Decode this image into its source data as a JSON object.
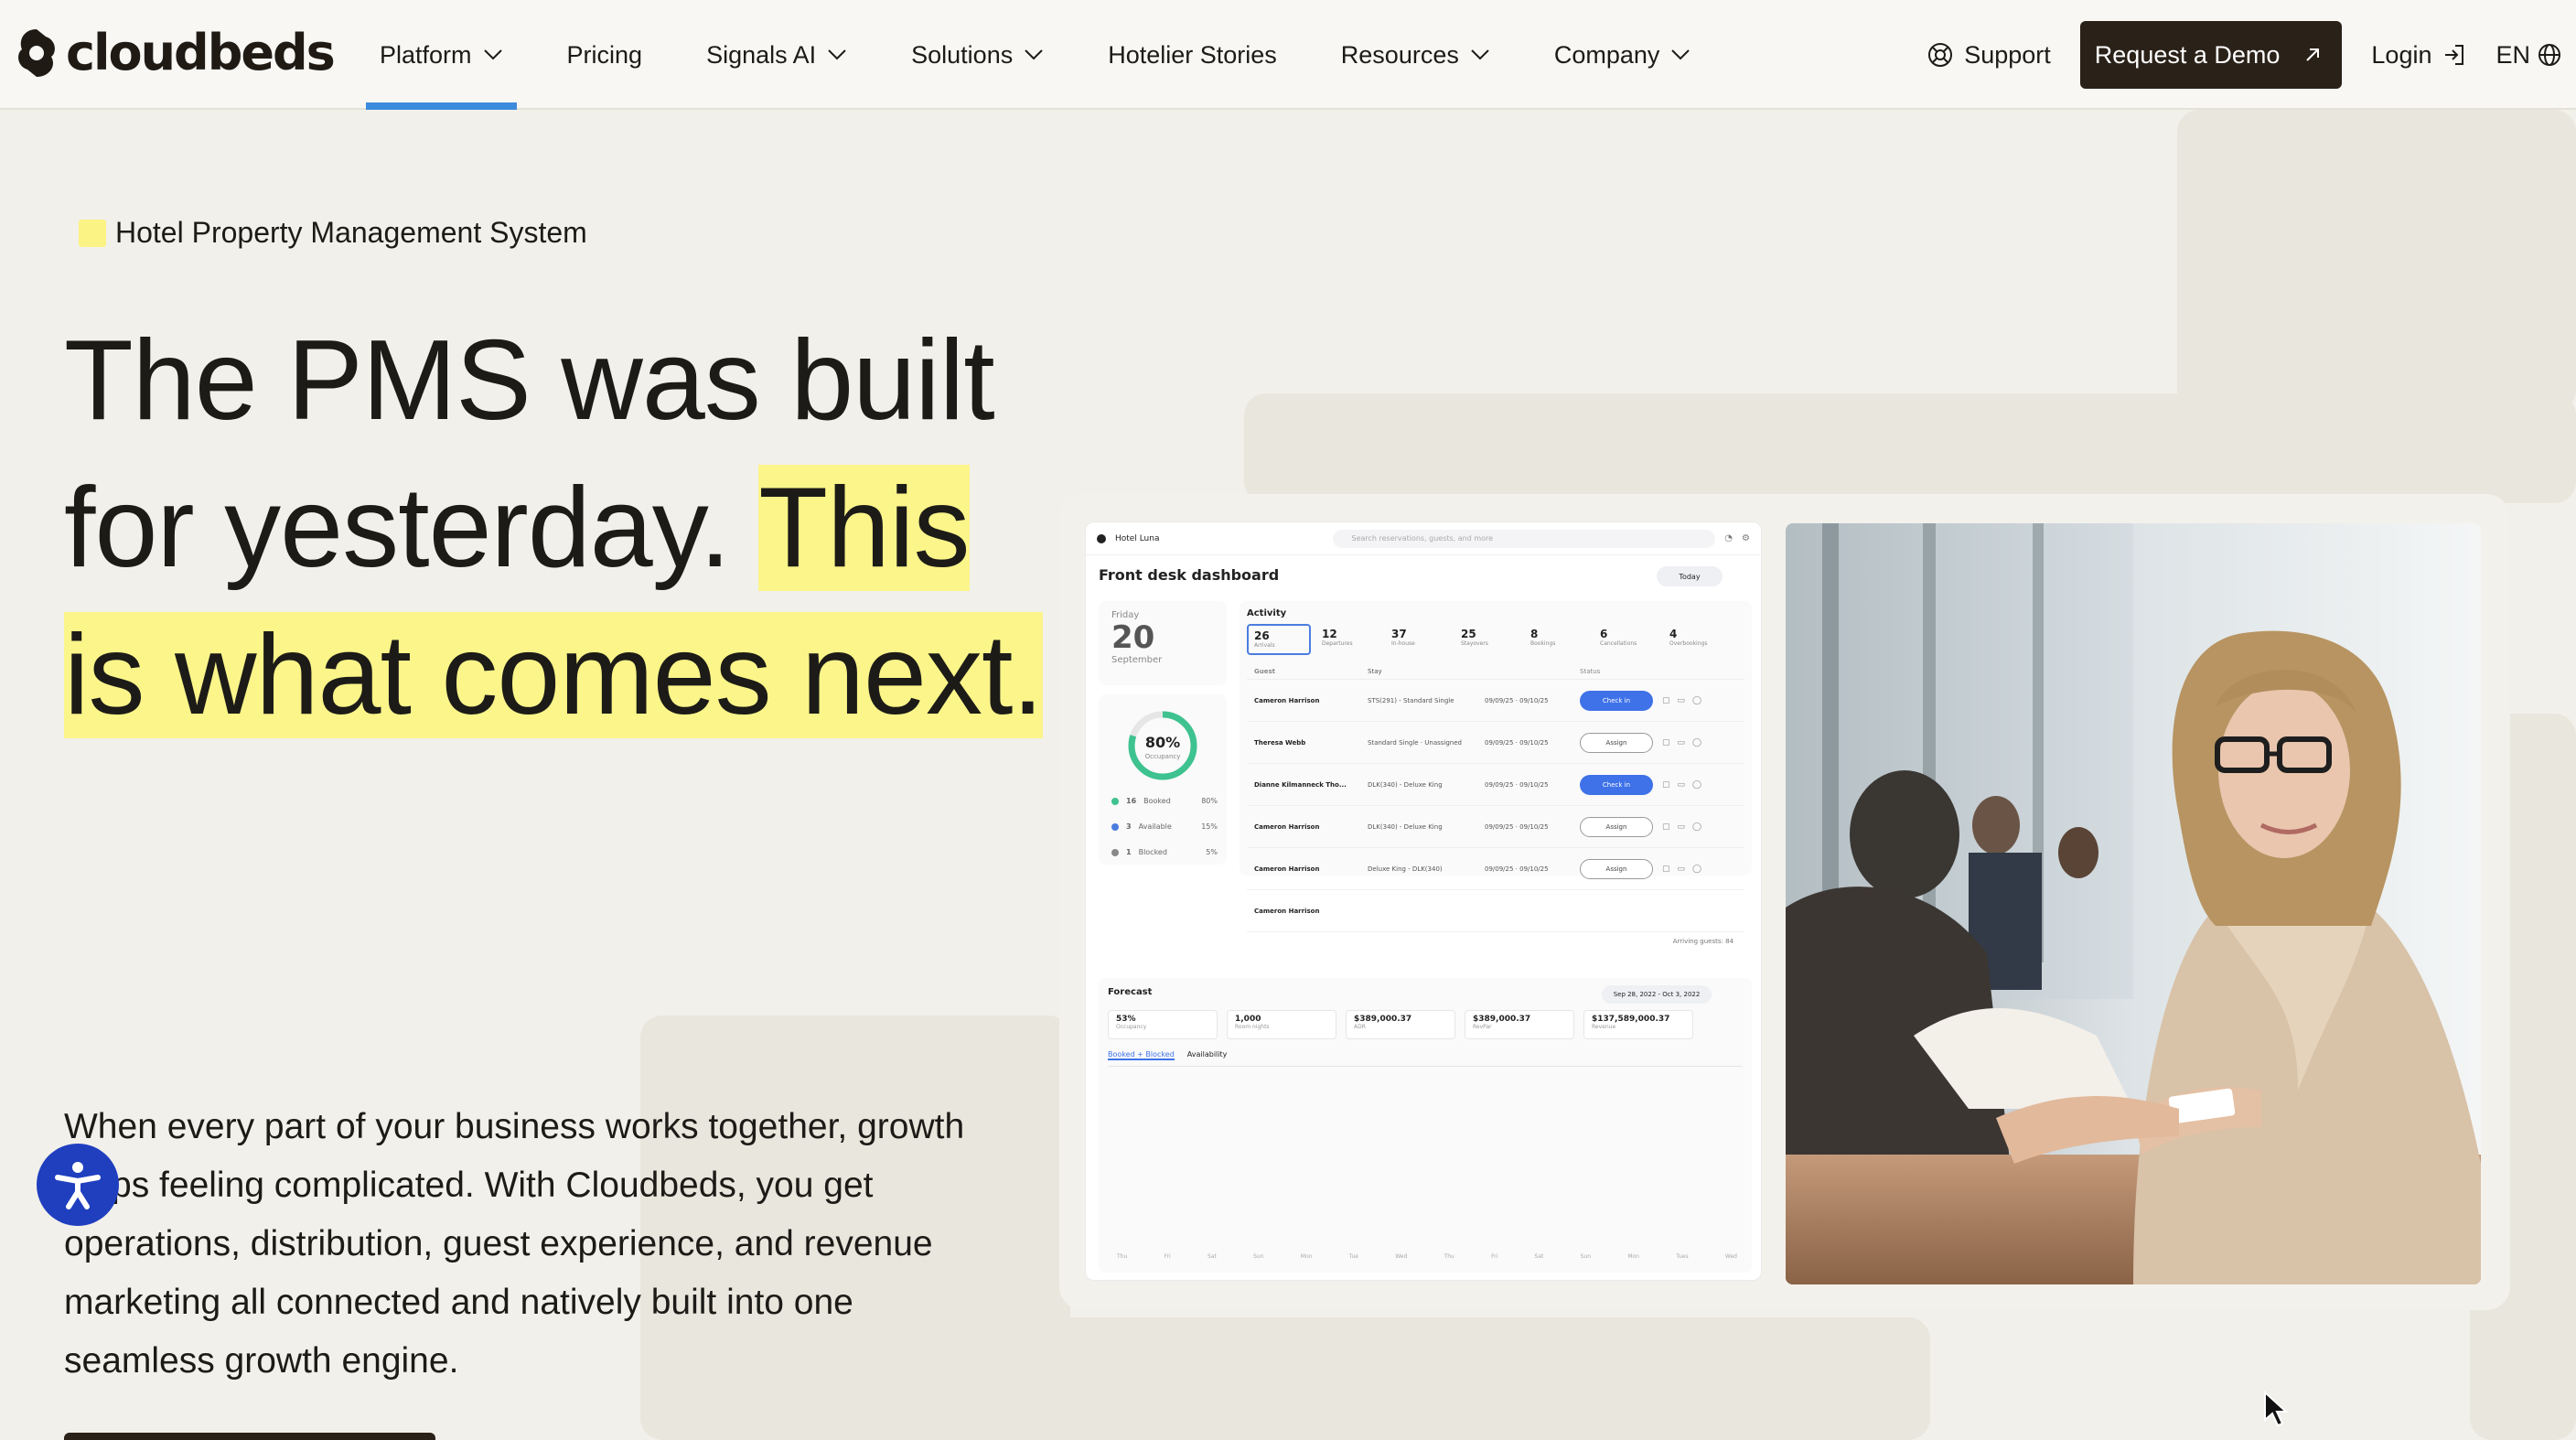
{
  "header": {
    "logo_text": "cloudbeds",
    "nav": [
      {
        "label": "Platform",
        "dropdown": true
      },
      {
        "label": "Pricing",
        "dropdown": false
      },
      {
        "label": "Signals AI",
        "dropdown": true
      },
      {
        "label": "Solutions",
        "dropdown": true
      },
      {
        "label": "Hotelier Stories",
        "dropdown": false
      },
      {
        "label": "Resources",
        "dropdown": true
      },
      {
        "label": "Company",
        "dropdown": true
      }
    ],
    "support_label": "Support",
    "demo_label": "Request a Demo",
    "login_label": "Login",
    "lang_label": "EN"
  },
  "hero": {
    "eyebrow": "Hotel Property Management System",
    "headline_plain": "The PMS was built for yesterday.",
    "headline_highlight": "This is what comes next.",
    "subcopy": "When every part of your business works together, growth stops feeling complicated. With Cloudbeds, you get operations, distribution, guest experience, and revenue marketing all connected and natively built into one seamless growth engine."
  },
  "dashboard": {
    "hotel_name": "Hotel Luna",
    "search_placeholder": "Search reservations, guests, and more",
    "title": "Front desk dashboard",
    "today_label": "Today",
    "date": {
      "dow": "Friday",
      "day": "20",
      "month": "September"
    },
    "occupancy": {
      "value": "80%",
      "label": "Occupancy",
      "fraction": 0.8,
      "rows": [
        {
          "count": "16",
          "label": "Booked",
          "pct": "80%",
          "color": "#3ec28f"
        },
        {
          "count": "3",
          "label": "Available",
          "pct": "15%",
          "color": "#4b7de0"
        },
        {
          "count": "1",
          "label": "Blocked",
          "pct": "5%",
          "color": "#888888"
        }
      ]
    },
    "activity": {
      "title": "Activity",
      "tabs": [
        {
          "value": "26",
          "label": "Arrivals"
        },
        {
          "value": "12",
          "label": "Departures"
        },
        {
          "value": "37",
          "label": "In-house"
        },
        {
          "value": "25",
          "label": "Stayovers"
        },
        {
          "value": "8",
          "label": "Bookings"
        },
        {
          "value": "6",
          "label": "Cancellations"
        },
        {
          "value": "4",
          "label": "Overbookings"
        }
      ],
      "columns": [
        "Guest",
        "Stay",
        "Status"
      ],
      "rows": [
        {
          "guest": "Cameron Harrison",
          "stay": "STS(291) - Standard Single",
          "dates": "09/09/25 · 09/10/25",
          "status": "Check in",
          "style": "fill"
        },
        {
          "guest": "Theresa Webb",
          "stay": "Standard Single · Unassigned",
          "dates": "09/09/25 · 09/10/25",
          "status": "Assign",
          "style": "line"
        },
        {
          "guest": "Dianne Kilmanneck Tho...",
          "stay": "DLK(340) - Deluxe King",
          "dates": "09/09/25 · 09/10/25",
          "status": "Check in",
          "style": "fill"
        },
        {
          "guest": "Cameron Harrison",
          "stay": "DLK(340) - Deluxe King",
          "dates": "09/09/25 · 09/10/25",
          "status": "Assign",
          "style": "line"
        },
        {
          "guest": "Cameron Harrison",
          "stay": "Deluxe King - DLK(340)",
          "dates": "09/09/25 · 09/10/25",
          "status": "Assign",
          "style": "line"
        },
        {
          "guest": "Cameron Harrison",
          "stay": "",
          "dates": "",
          "status": "",
          "style": "none"
        }
      ],
      "footer": "Arriving guests: 84"
    },
    "forecast": {
      "title": "Forecast",
      "range": "Sep 28, 2022 - Oct 3, 2022",
      "stats": [
        {
          "value": "53%",
          "label": "Occupancy"
        },
        {
          "value": "1,000",
          "label": "Room nights"
        },
        {
          "value": "$389,000.37",
          "label": "ADR"
        },
        {
          "value": "$389,000.37",
          "label": "RevPar"
        },
        {
          "value": "$137,589,000.37",
          "label": "Revenue"
        }
      ],
      "tabs": [
        "Booked + Blocked",
        "Availability"
      ],
      "axis": [
        "Thu",
        "Fri",
        "Sat",
        "Sun",
        "Mon",
        "Tue",
        "Wed",
        "Thu",
        "Fri",
        "Sat",
        "Sun",
        "Mon",
        "Tues",
        "Wed"
      ]
    }
  },
  "colors": {
    "accent_blue": "#3d8bdc",
    "highlight_yellow": "#fbf58a",
    "dark_button": "#2a2118",
    "a11y_blue": "#1f3fbf"
  },
  "icons": [
    "chevron-down-icon",
    "support-icon",
    "external-arrow-icon",
    "login-icon",
    "globe-icon",
    "accessibility-icon",
    "cursor-icon"
  ]
}
